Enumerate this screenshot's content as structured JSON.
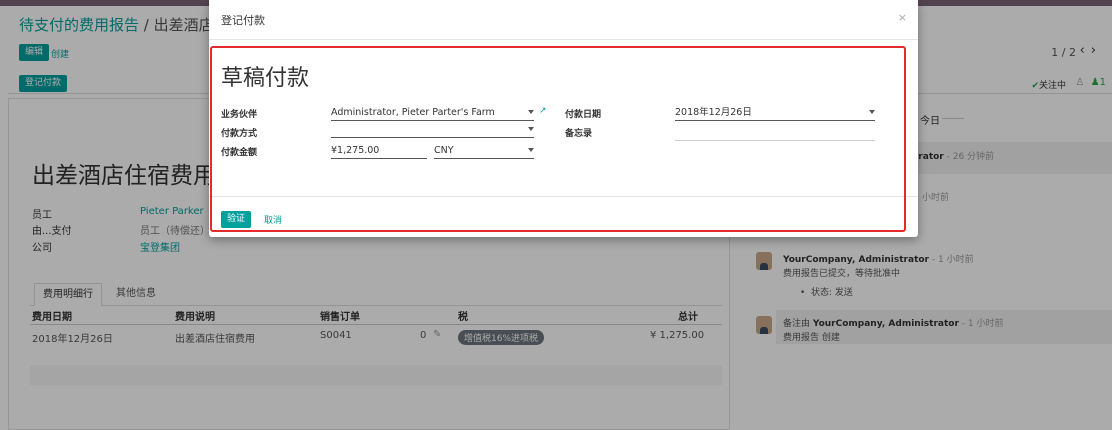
{
  "colors": {
    "accent": "#00a09d",
    "topbar": "#7c6576",
    "highlight": "#e32b2b"
  },
  "breadcrumb": {
    "parent": "待支付的费用报告",
    "separator": "/",
    "current": "出差酒店住宿"
  },
  "toolbar": {
    "edit_label": "编辑",
    "create_label": "创建"
  },
  "pager": {
    "value": "1 / 2"
  },
  "statusbar": {
    "register_payment_label": "登记付款",
    "follow_label": "关注中",
    "followers_count": "1"
  },
  "record": {
    "title": "出差酒店住宿费用",
    "fields": [
      {
        "label": "员工",
        "value": "Pieter Parker",
        "link": true
      },
      {
        "label": "由...支付",
        "value": "员工（待偿还）",
        "link": false
      },
      {
        "label": "公司",
        "value": "宝登集团",
        "link": true
      }
    ],
    "tabs": [
      "费用明细行",
      "其他信息"
    ],
    "columns": [
      "费用日期",
      "费用说明",
      "销售订单",
      "税",
      "总计"
    ],
    "rows": [
      {
        "date": "2018年12月26日",
        "description": "出差酒店住宿费用",
        "sale_order": "S0041",
        "qty": "0",
        "tax": "增值税16%进项税",
        "total": "¥ 1,275.00"
      }
    ]
  },
  "chatter": {
    "today_label": "今日",
    "messages": [
      {
        "author": "trator",
        "time": "- 26 分钟前"
      },
      {
        "author": "",
        "time": "小时前"
      },
      {
        "author": "YourCompany, Administrator",
        "time": "- 1 小时前",
        "text": "费用报告已提交，等待批准中",
        "bullet": "状态: 发送"
      },
      {
        "prefix": "备注由",
        "author": "YourCompany, Administrator",
        "time": "- 1 小时前",
        "text": "费用报告 创建"
      }
    ]
  },
  "modal": {
    "title": "登记付款",
    "close_symbol": "×",
    "heading": "草稿付款",
    "partner": {
      "label": "业务伙伴",
      "value": "Administrator, Pieter Parter's Farm"
    },
    "payment_method": {
      "label": "付款方式",
      "value": ""
    },
    "amount": {
      "label": "付款金额",
      "value": "¥1,275.00",
      "currency": "CNY"
    },
    "payment_date": {
      "label": "付款日期",
      "value": "2018年12月26日"
    },
    "memo": {
      "label": "备忘录",
      "value": ""
    },
    "verify_label": "验证",
    "cancel_label": "取消"
  }
}
